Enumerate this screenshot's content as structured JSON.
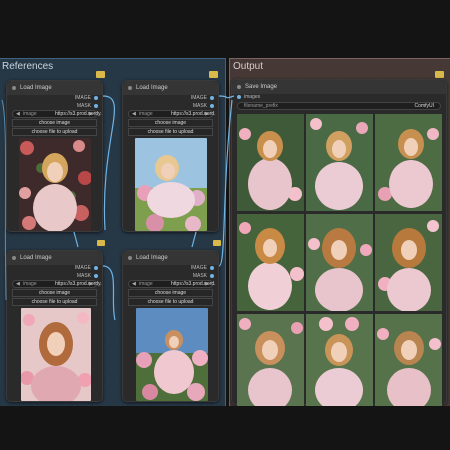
{
  "groups": {
    "references": {
      "title": "References"
    },
    "output": {
      "title": "Output"
    }
  },
  "load_nodes": [
    {
      "title": "Load Image",
      "output_image": "IMAGE",
      "output_mask": "MASK",
      "image_label": "image",
      "image_value": "https://s3.prod.nordy.",
      "choose_label": "choose image",
      "upload_label": "choose file to upload",
      "palette": "pink"
    },
    {
      "title": "Load Image",
      "output_image": "IMAGE",
      "output_mask": "MASK",
      "image_label": "image",
      "image_value": "https://s3.prod.nord.",
      "choose_label": "choose image",
      "upload_label": "choose file to upload",
      "palette": "sky"
    },
    {
      "title": "Load Image",
      "output_image": "IMAGE",
      "output_mask": "MASK",
      "image_label": "image",
      "image_value": "https://s3.prod.nordy.",
      "choose_label": "choose image",
      "upload_label": "choose file to upload",
      "palette": "rose"
    },
    {
      "title": "Load Image",
      "output_image": "IMAGE",
      "output_mask": "MASK",
      "image_label": "image",
      "image_value": "https://s3.prod.nord.",
      "choose_label": "choose image",
      "upload_label": "choose file to upload",
      "palette": "garden"
    }
  ],
  "save_node": {
    "title": "Save Image",
    "input_images": "images",
    "prefix_label": "filename_prefix",
    "prefix_value": "ComfyUI",
    "gallery_count": 9
  },
  "colors": {
    "references_bg": "#345470",
    "output_bg": "#6e5650",
    "wire": "#6fb4e4",
    "badge": "#d8b94a"
  }
}
